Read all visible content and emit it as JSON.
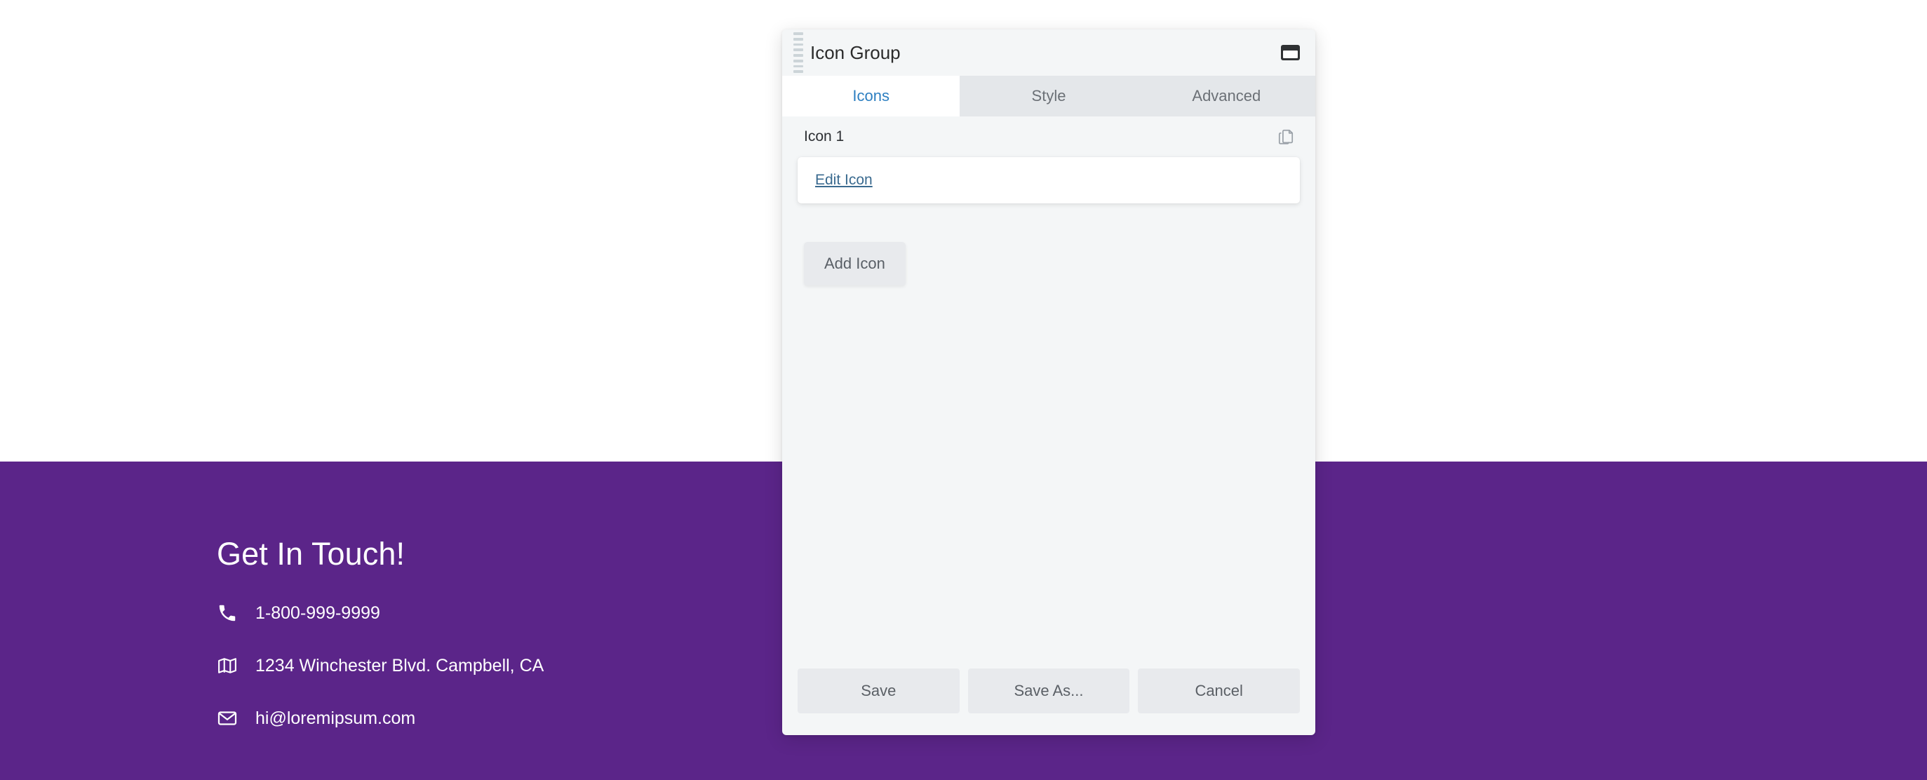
{
  "theme": {
    "footer_bg": "#5b2589",
    "panel_bg": "#f4f6f7",
    "tab_active_text": "#2d7fc1",
    "tab_inactive_bg": "#e4e7ea",
    "link_color": "#3a6a8f",
    "button_bg": "#e8eaed"
  },
  "panel": {
    "title": "Icon Group",
    "drag_handle_icon": "drag-handle-icon",
    "window_icon": "window-restore-icon",
    "tabs": [
      {
        "label": "Icons",
        "active": true
      },
      {
        "label": "Style",
        "active": false
      },
      {
        "label": "Advanced",
        "active": false
      }
    ],
    "items": [
      {
        "label": "Icon 1",
        "copy_icon": "copy-icon",
        "edit_link": "Edit Icon"
      }
    ],
    "add_button": "Add Icon",
    "footer_buttons": [
      {
        "label": "Save"
      },
      {
        "label": "Save As..."
      },
      {
        "label": "Cancel"
      }
    ]
  },
  "site_footer": {
    "heading": "Get In Touch!",
    "contacts": [
      {
        "icon": "phone-icon",
        "text": "1-800-999-9999"
      },
      {
        "icon": "map-icon",
        "text": "1234 Winchester Blvd. Campbell, CA"
      },
      {
        "icon": "envelope-icon",
        "text": "hi@loremipsum.com"
      }
    ]
  }
}
